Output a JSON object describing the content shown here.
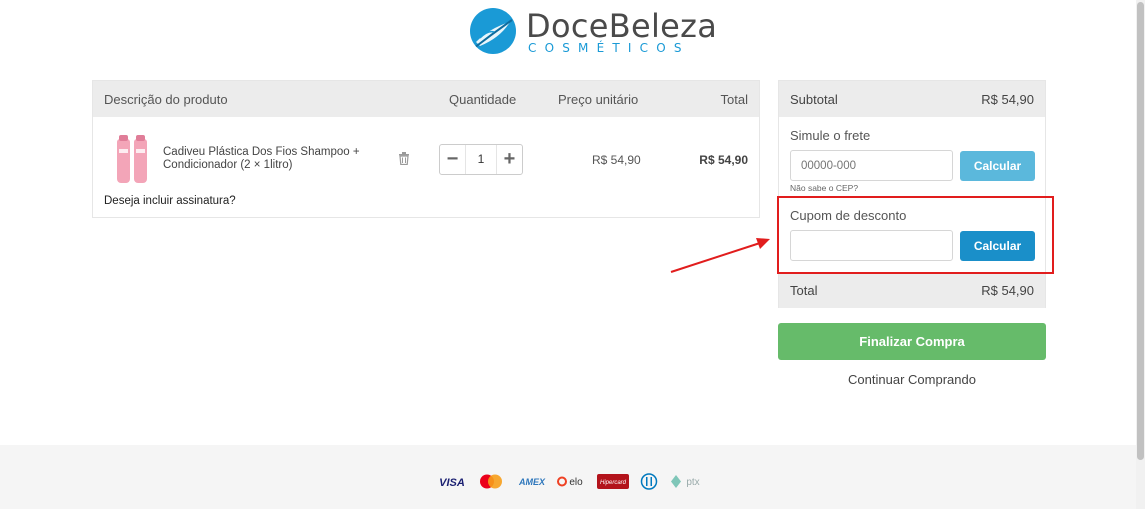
{
  "brand": {
    "name": "DoceBeleza",
    "tagline": "COSMÉTICOS",
    "color": "#1a9ad6"
  },
  "cart": {
    "columns": [
      "Descrição do produto",
      "Quantidade",
      "Preço unitário",
      "Total"
    ],
    "item": {
      "name": "Cadiveu Plástica Dos Fios Shampoo + Condicionador (2 × 1litro)",
      "quantity": "1",
      "unit_price": "R$ 54,90",
      "total": "R$ 54,90"
    },
    "subscription_prompt": "Deseja incluir assinatura?"
  },
  "summary": {
    "subtotal_label": "Subtotal",
    "subtotal_value": "R$ 54,90",
    "shipping": {
      "title": "Simule o frete",
      "placeholder": "00000-000",
      "button": "Calcular",
      "hint": "Não sabe o CEP?"
    },
    "coupon": {
      "title": "Cupom de desconto",
      "placeholder": "",
      "button": "Calcular"
    },
    "total_label": "Total",
    "total_value": "R$ 54,90"
  },
  "actions": {
    "checkout": "Finalizar Compra",
    "continue": "Continuar Comprando"
  },
  "payment_methods": [
    "VISA",
    "Mastercard",
    "AMEX",
    "elo",
    "Hipercard",
    "Diners Club",
    "ptx"
  ],
  "colors": {
    "checkout_green": "#66bb6a",
    "calc_blue": "#1a8fc9",
    "calc_blue_light": "#5bb8dc",
    "annotation_red": "#e11d1d"
  }
}
